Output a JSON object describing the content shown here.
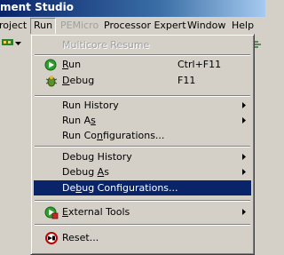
{
  "window": {
    "title": "ment Studio"
  },
  "menubar": {
    "items": [
      {
        "label": "roject"
      },
      {
        "label": "Run"
      },
      {
        "label": "PEMicro"
      },
      {
        "label": "Processor Expert"
      },
      {
        "label": "Window"
      },
      {
        "label": "Help"
      }
    ]
  },
  "run_menu": {
    "items": [
      {
        "label": "Multicore Resume",
        "enabled": false
      },
      {
        "label": "Run",
        "accelerator": "Ctrl+F11",
        "icon": "run-icon"
      },
      {
        "label": "Debug",
        "accelerator": "F11",
        "icon": "debug-icon"
      },
      {
        "label": "Run History",
        "submenu": true
      },
      {
        "label": "Run As",
        "submenu": true
      },
      {
        "label": "Run Configurations..."
      },
      {
        "label": "Debug History",
        "submenu": true
      },
      {
        "label": "Debug As",
        "submenu": true
      },
      {
        "label": "Debug Configurations...",
        "selected": true
      },
      {
        "label": "External Tools",
        "submenu": true,
        "icon": "external-tools-icon"
      },
      {
        "label": "Reset...",
        "icon": "reset-icon"
      }
    ]
  },
  "colors": {
    "menu_background": "#d4d0c8",
    "selection": "#0a246a",
    "disabled_text": "#a0a0a0"
  }
}
